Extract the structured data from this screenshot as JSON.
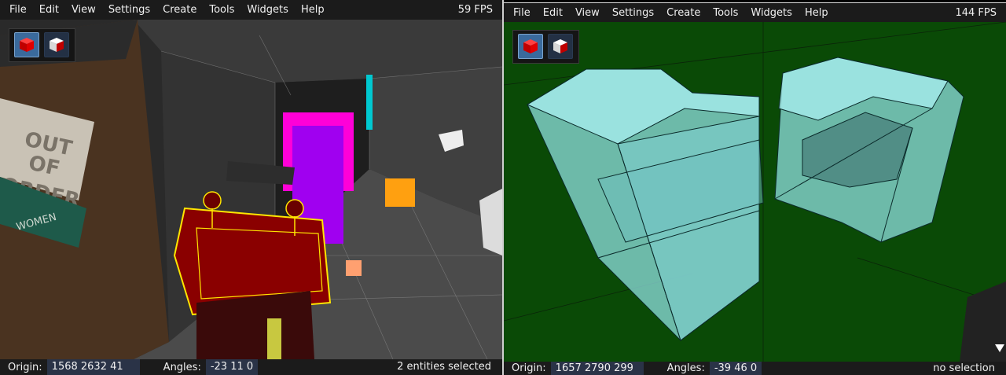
{
  "left_viewport": {
    "menu": [
      "File",
      "Edit",
      "View",
      "Settings",
      "Create",
      "Tools",
      "Widgets",
      "Help"
    ],
    "fps": "59 FPS",
    "scene_sign": {
      "line1": "OUT",
      "line2": "OF",
      "line3": "ORDER",
      "lower": "WOMEN"
    },
    "status": {
      "origin_label": "Origin:",
      "origin_value": "1568 2632 41",
      "angles_label": "Angles:",
      "angles_value": "-23 11 0",
      "selection": "2 entities selected"
    }
  },
  "right_viewport": {
    "menu": [
      "File",
      "Edit",
      "View",
      "Settings",
      "Create",
      "Tools",
      "Widgets",
      "Help"
    ],
    "fps": "144 FPS",
    "status": {
      "origin_label": "Origin:",
      "origin_value": "1657 2790 299",
      "angles_label": "Angles:",
      "angles_value": "-39 46 0",
      "selection": "no selection"
    }
  },
  "colors": {
    "menubar": "#1b1b1b",
    "status_value_bg": "#2a3347",
    "selection_highlight": "#ffe600",
    "selected_fill": "#8a0000",
    "brush_magenta": "#ff00d8",
    "brush_purple": "#a000f0",
    "entity_orange": "#ffa010",
    "void_green": "#0a4a06",
    "glass_cyan": "#8fe0e0"
  },
  "icons": {
    "mode_brush": "red-cube-icon",
    "mode_entity": "white-cube-icon",
    "dropdown": "triangle-down-icon"
  }
}
